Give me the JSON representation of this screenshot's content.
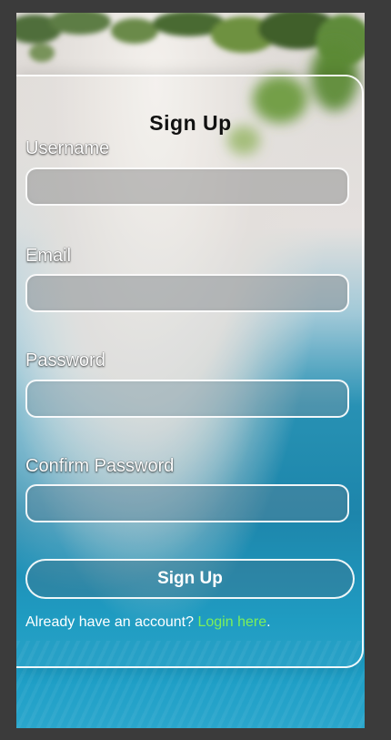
{
  "form": {
    "title": "Sign Up",
    "fields": [
      {
        "label": "Username",
        "value": "",
        "placeholder": ""
      },
      {
        "label": "Email",
        "value": "",
        "placeholder": ""
      },
      {
        "label": "Password",
        "value": "",
        "placeholder": ""
      },
      {
        "label": "Confirm Password",
        "value": "",
        "placeholder": ""
      }
    ],
    "submit_label": "Sign Up",
    "footer_text": "Already have an account?",
    "login_link": "Login here",
    "footer_end": "."
  },
  "colors": {
    "link": "#7cf05a",
    "title": "#111111",
    "page_background": "#3b3b3b"
  },
  "background": {
    "description_icon": "beach-aerial-background"
  }
}
